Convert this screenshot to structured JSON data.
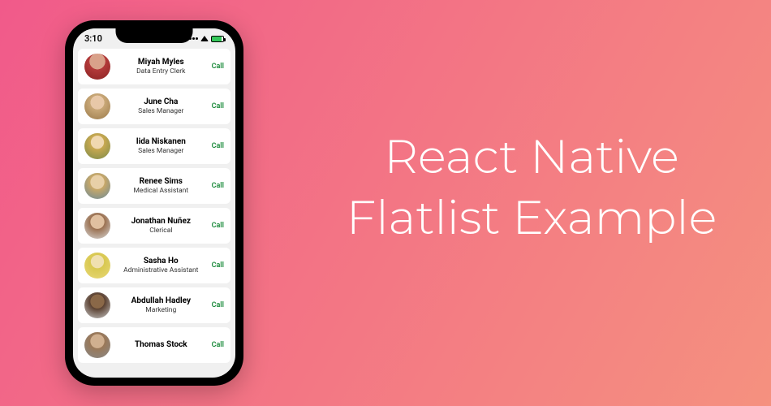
{
  "headline": {
    "line1": "React Native",
    "line2": "Flatlist Example"
  },
  "status": {
    "time": "3:10"
  },
  "call_label": "Call",
  "contacts": [
    {
      "name": "Miyah Myles",
      "role": "Data Entry Clerk",
      "avatar_class": "av1"
    },
    {
      "name": "June Cha",
      "role": "Sales Manager",
      "avatar_class": "av2"
    },
    {
      "name": "Iida Niskanen",
      "role": "Sales Manager",
      "avatar_class": "av3"
    },
    {
      "name": "Renee Sims",
      "role": "Medical Assistant",
      "avatar_class": "av4"
    },
    {
      "name": "Jonathan Nuñez",
      "role": "Clerical",
      "avatar_class": "av5"
    },
    {
      "name": "Sasha Ho",
      "role": "Administrative Assistant",
      "avatar_class": "av6"
    },
    {
      "name": "Abdullah Hadley",
      "role": "Marketing",
      "avatar_class": "av7"
    },
    {
      "name": "Thomas Stock",
      "role": "",
      "avatar_class": "av8"
    }
  ]
}
